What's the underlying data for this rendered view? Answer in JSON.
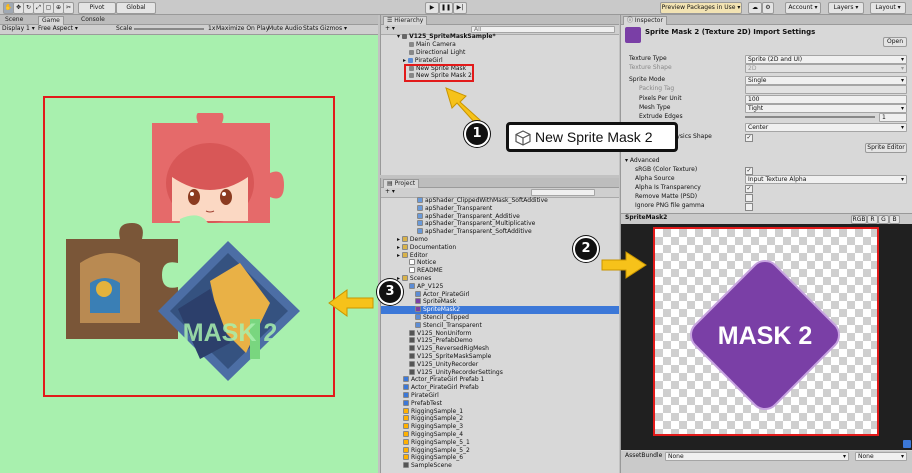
{
  "toolbar": {
    "pivot": "Pivot",
    "global": "Global",
    "preview_packages": "Preview Packages in Use ▾",
    "account": "Account ▾",
    "layers": "Layers ▾",
    "layout": "Layout ▾"
  },
  "game": {
    "tabs": [
      "Scene",
      "Game",
      "Console"
    ],
    "display": "Display 1 ▾",
    "aspect": "Free Aspect ▾",
    "scale_label": "Scale",
    "scale_value": "1x",
    "maximize": "Maximize On Play",
    "mute": "Mute Audio",
    "stats": "Stats",
    "gizmos": "Gizmos ▾",
    "mask_text": "MASK 2"
  },
  "hierarchy": {
    "title": "Hierarchy",
    "search_placeholder": "All",
    "scene": "V125_SpriteMaskSample*",
    "items": [
      "Main Camera",
      "Directional Light",
      "PirateGirl",
      "New Sprite Mask",
      "New Sprite Mask 2"
    ],
    "callout": "New Sprite Mask 2"
  },
  "project": {
    "title": "Project",
    "items": [
      "apShader_ClippedWithMask_SoftAdditive",
      "apShader_Transparent",
      "apShader_Transparent_Additive",
      "apShader_Transparent_Multiplicative",
      "apShader_Transparent_SoftAdditive",
      "Demo",
      "Documentation",
      "Editor",
      "Notice",
      "README",
      "Scenes",
      "AP_V125",
      "Actor_PirateGirl",
      "SpriteMask",
      "SpriteMask2",
      "Stencil_Clipped",
      "Stencil_Transparent",
      "V125_NonUniform",
      "V125_PrefabDemo",
      "V125_ReversedRigMesh",
      "V125_SpriteMaskSample",
      "V125_UnityRecorder",
      "V125_UnityRecorderSettings",
      "Actor_PirateGirl Prefab 1",
      "Actor_PirateGirl Prefab",
      "PirateGirl",
      "PrefabTest",
      "RiggingSample_1",
      "RiggingSample_2",
      "RiggingSample_3",
      "RiggingSample_4",
      "RiggingSample_5_1",
      "RiggingSample_5_2",
      "RiggingSample_6",
      "SampleScene"
    ]
  },
  "inspector": {
    "title": "Inspector",
    "header": "Sprite Mask 2 (Texture 2D) Import Settings",
    "open": "Open",
    "rows": [
      {
        "label": "Texture Type",
        "value": "Sprite (2D and UI)"
      },
      {
        "label": "Texture Shape",
        "value": "2D"
      },
      {
        "label": "Sprite Mode",
        "value": "Single"
      },
      {
        "label": "Packing Tag",
        "value": ""
      },
      {
        "label": "Pixels Per Unit",
        "value": "100"
      },
      {
        "label": "Mesh Type",
        "value": "Tight"
      },
      {
        "label": "Extrude Edges",
        "value": "1"
      },
      {
        "label": "Pivot",
        "value": "Center"
      },
      {
        "label": "Generate Physics Shape",
        "value": "✓"
      }
    ],
    "sprite_editor": "Sprite Editor",
    "advanced": "Advanced",
    "adv_rows": [
      {
        "label": "sRGB (Color Texture)",
        "value": "✓"
      },
      {
        "label": "Alpha Source",
        "value": "Input Texture Alpha"
      },
      {
        "label": "Alpha Is Transparency",
        "value": "✓"
      },
      {
        "label": "Remove Matte (PSD)",
        "value": ""
      },
      {
        "label": "Ignore PNG file gamma",
        "value": ""
      }
    ],
    "preview_title": "SpriteMask2",
    "channels": [
      "RGB",
      "R",
      "G",
      "B"
    ],
    "preview_text": "MASK 2",
    "asset_bundle": "AssetBundle",
    "none1": "None",
    "none2": "None"
  },
  "badges": [
    "1",
    "2",
    "3"
  ],
  "colors": {
    "accent_red": "#e21a1a",
    "arrow_yellow": "#f6c21a",
    "mask_purple": "#7a3fa6",
    "game_bg": "#a8f0ae",
    "selection": "#3c78d8"
  }
}
